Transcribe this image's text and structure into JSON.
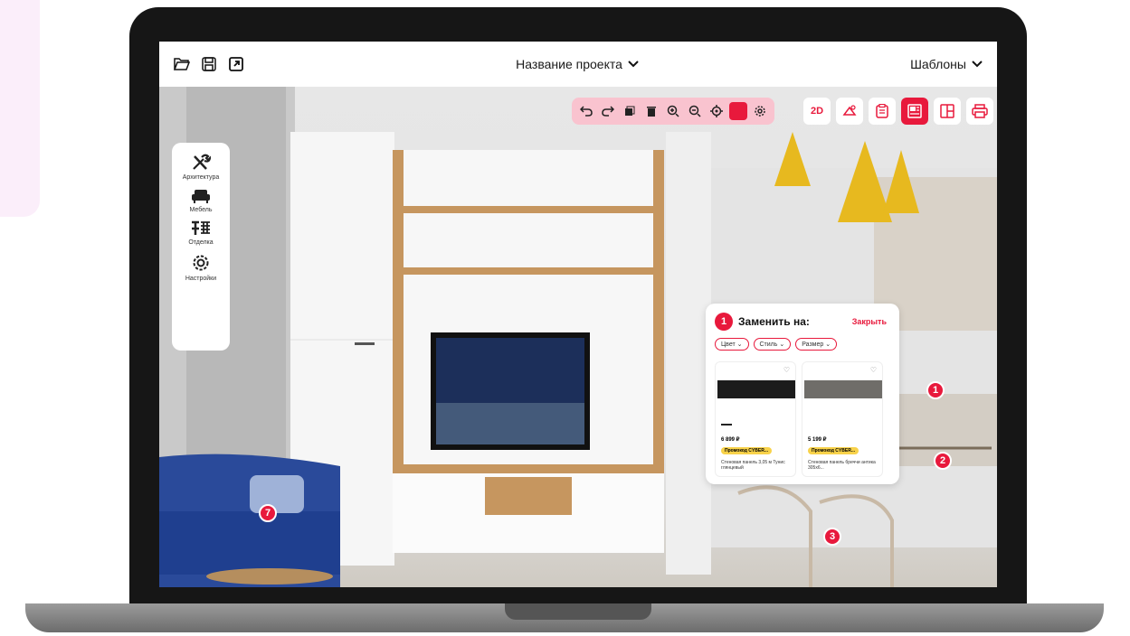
{
  "topbar": {
    "project_title": "Название проекта",
    "templates_label": "Шаблоны"
  },
  "sidebar": {
    "items": [
      {
        "label": "Архитектура",
        "icon": "tools-icon"
      },
      {
        "label": "Мебель",
        "icon": "sofa-icon"
      },
      {
        "label": "Отделка",
        "icon": "brick-icon"
      },
      {
        "label": "Настройки",
        "icon": "gear-icon"
      }
    ]
  },
  "right_tools": {
    "two_d_label": "2D"
  },
  "popup": {
    "number": "1",
    "title": "Заменить на:",
    "close_label": "Закрыть",
    "filters": [
      "Цвет",
      "Стиль",
      "Размер"
    ],
    "cards": [
      {
        "price": "6 899 ₽",
        "promo": "Промокод CYBER...",
        "desc": "Стеновая панель 3,05 м Тунис глянцевый"
      },
      {
        "price": "5 199 ₽",
        "promo": "Промокод CYBER...",
        "desc": "Стеновая панель бреччи антика 305х6..."
      }
    ]
  },
  "markers": [
    "1",
    "2",
    "3",
    "7"
  ],
  "colors": {
    "accent": "#e8193c",
    "accent_light": "#f9c3cf",
    "promo": "#f8d24a"
  }
}
